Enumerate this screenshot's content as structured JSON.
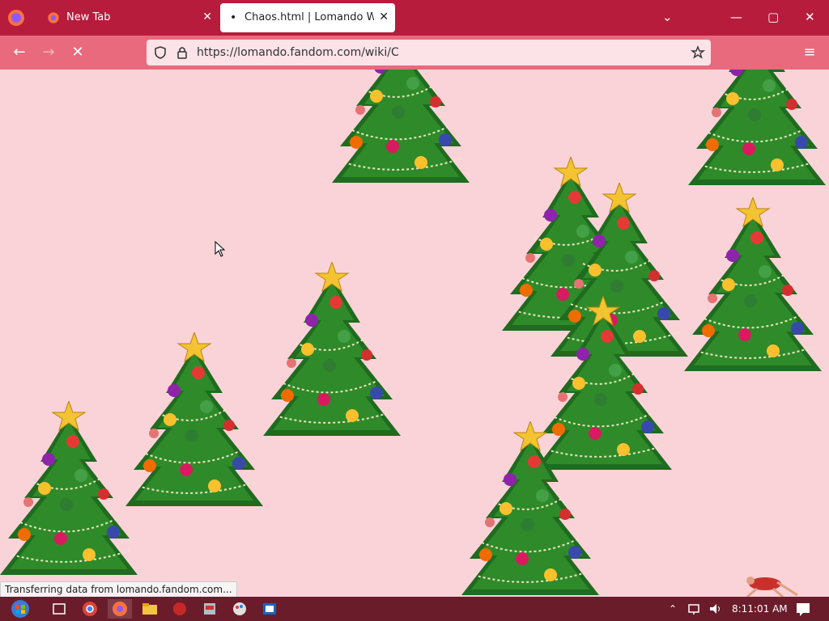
{
  "browser": {
    "tabs": [
      {
        "title": "New Tab",
        "close": "✕"
      },
      {
        "title": "Chaos.html | Lomando Wiki | Fa",
        "close": "✕"
      }
    ],
    "url": "https://lomando.fandom.com/wiki/C",
    "nav": {
      "back": "←",
      "forward": "→",
      "stop": "✕",
      "menu": "≡"
    },
    "window": {
      "minimize": "—",
      "maximize": "▢",
      "close": "✕",
      "tab_list": "⌄"
    }
  },
  "status_text": "Transferring data from lomando.fandom.com...",
  "taskbar": {
    "time": "8:11:01 AM"
  },
  "colors": {
    "tab_bar": "#b71c3c",
    "nav_bar": "#e86a7c",
    "page_bg": "#fad3d9",
    "taskbar": "#6a1c2a"
  }
}
